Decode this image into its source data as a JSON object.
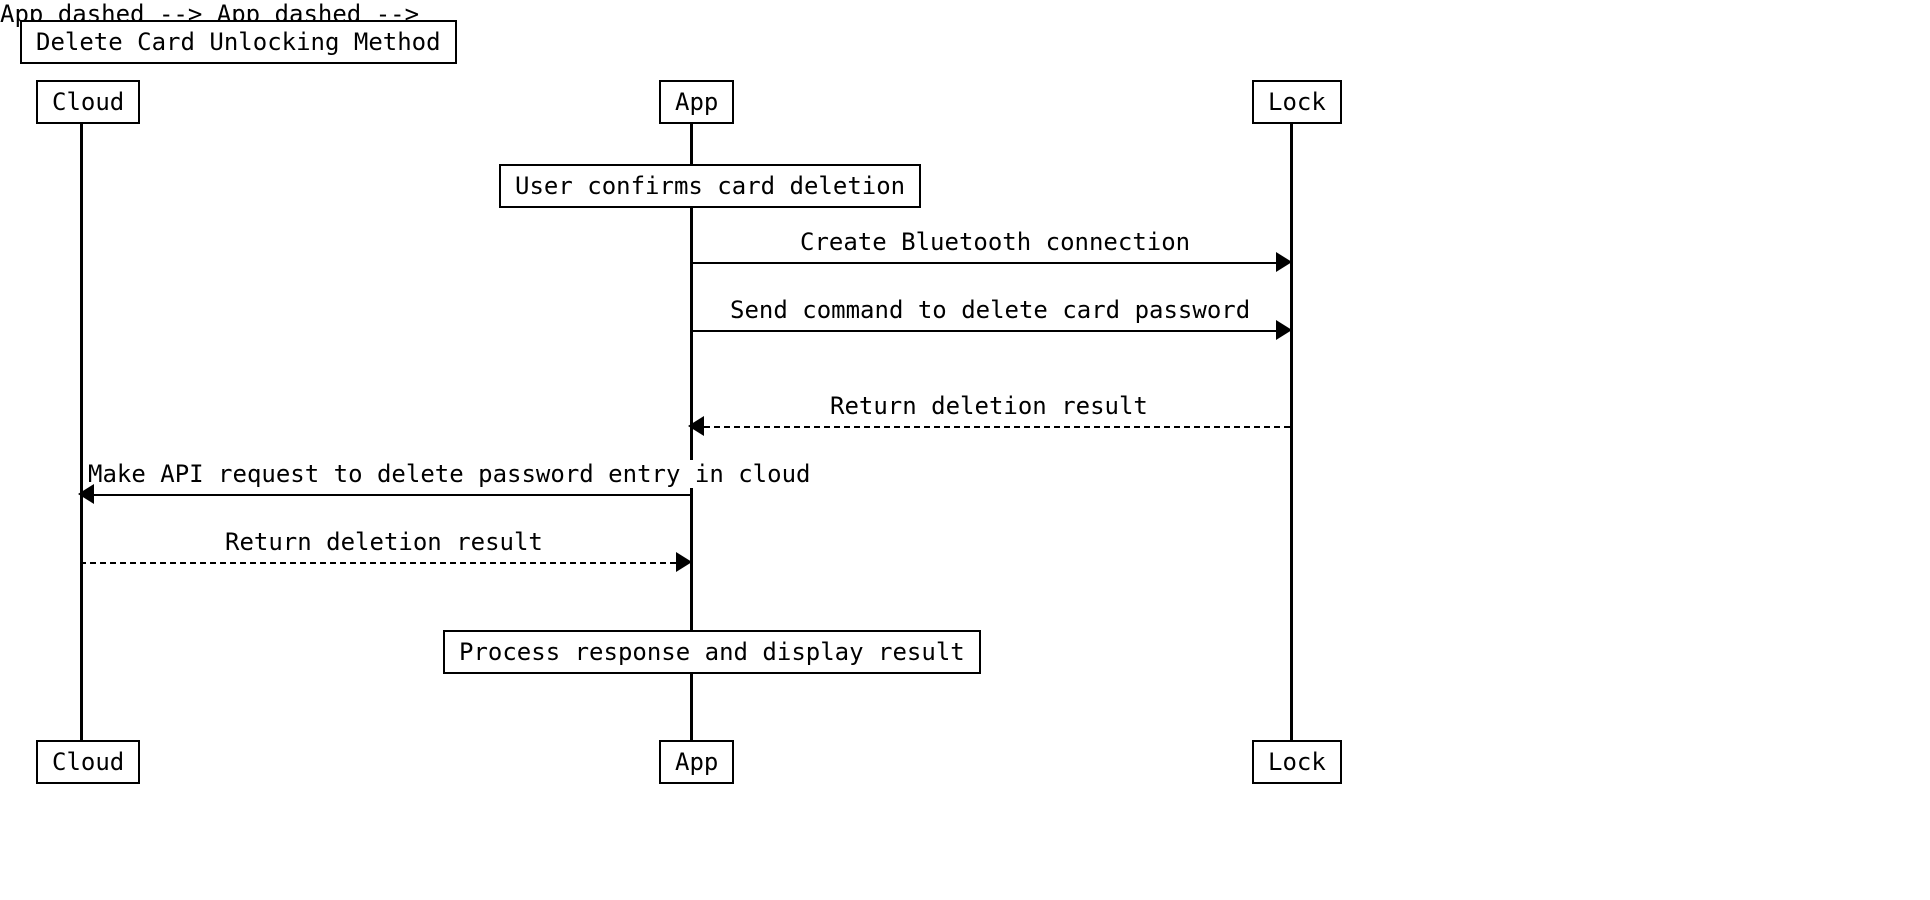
{
  "diagram": {
    "title": "Delete Card Unlocking Method",
    "participants": [
      "Cloud",
      "App",
      "Lock"
    ],
    "notes": {
      "user_confirm": "User confirms card deletion",
      "process_response": "Process response and display result"
    },
    "messages": {
      "m1": "Create Bluetooth connection",
      "m2": "Send command to delete card password",
      "m3": "Return deletion result",
      "m4": "Make API request to delete password entry in cloud",
      "m5": "Return deletion result"
    }
  },
  "chart_data": {
    "type": "sequence",
    "title": "Delete Card Unlocking Method",
    "participants": [
      "Cloud",
      "App",
      "Lock"
    ],
    "events": [
      {
        "kind": "note",
        "over": "App",
        "text": "User confirms card deletion"
      },
      {
        "kind": "message",
        "from": "App",
        "to": "Lock",
        "text": "Create Bluetooth connection",
        "style": "solid"
      },
      {
        "kind": "message",
        "from": "App",
        "to": "Lock",
        "text": "Send command to delete card password",
        "style": "solid"
      },
      {
        "kind": "message",
        "from": "Lock",
        "to": "App",
        "text": "Return deletion result",
        "style": "dashed"
      },
      {
        "kind": "message",
        "from": "App",
        "to": "Cloud",
        "text": "Make API request to delete password entry in cloud",
        "style": "solid"
      },
      {
        "kind": "message",
        "from": "Cloud",
        "to": "App",
        "text": "Return deletion result",
        "style": "dashed"
      },
      {
        "kind": "note",
        "over": "App",
        "text": "Process response and display result"
      }
    ]
  }
}
